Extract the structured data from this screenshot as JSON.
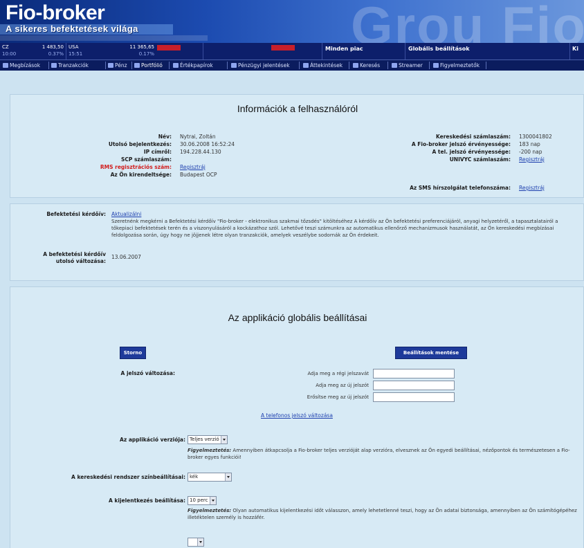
{
  "header": {
    "logo": "Fio-broker",
    "slogan": "A sikeres befektetések világa",
    "watermark": "Grou Fio"
  },
  "ticker": {
    "cz_label": "CZ",
    "cz_value": "1 483,50",
    "cz_time": "10:00",
    "cz_change": "0.37%",
    "usa_label": "USA",
    "usa_time": "15:51",
    "usa_value": "11 365,65",
    "usa_change": "0.17%",
    "market": "Minden piac",
    "global": "Globális beállítások",
    "right": "Ki"
  },
  "nav": {
    "tabs": [
      {
        "label": "Megbízások",
        "icon": "orders-icon"
      },
      {
        "label": "Tranzakciók",
        "icon": "transactions-icon"
      },
      {
        "label": "Pénz",
        "icon": "money-icon"
      },
      {
        "label": "Portfólió",
        "icon": "portfolio-icon"
      },
      {
        "label": "Értékpapírok",
        "icon": "securities-icon"
      },
      {
        "label": "Pénzügyi jelentések",
        "icon": "reports-icon"
      },
      {
        "label": "Áttekintések",
        "icon": "overview-icon"
      },
      {
        "label": "Keresés",
        "icon": "search-icon"
      },
      {
        "label": "Streamer",
        "icon": "streamer-icon"
      },
      {
        "label": "Figyelmeztetők",
        "icon": "alerts-icon"
      }
    ]
  },
  "user_info": {
    "title": "Információk a felhasználóról",
    "left": [
      {
        "label": "Név:",
        "value": "Nytrai, Zoltán"
      },
      {
        "label": "Utolsó bejelentkezés:",
        "value": "30.06.2008 16:52:24"
      },
      {
        "label": "IP címről:",
        "value": "194.228.44.130"
      },
      {
        "label": "SCP számlaszám:",
        "value": ""
      },
      {
        "label": "RMS regisztrációs szám:",
        "value": "Regisztráj"
      },
      {
        "label": "Az Ön kirendeltsége:",
        "value": "Budapest OCP"
      }
    ],
    "right": [
      {
        "label": "Kereskedési számlaszám:",
        "value": "1300041802"
      },
      {
        "label": "A Fio-broker jelszó érvényessége:",
        "value": "183 nap"
      },
      {
        "label": "A tel. jelszó érvényessége:",
        "value": "-200 nap"
      },
      {
        "label": "UNIVYC számlaszám:",
        "value": "Regisztráj"
      },
      {
        "label": "Az SMS hírszolgálat telefonszáma:",
        "value": "Regisztráj"
      }
    ]
  },
  "questionnaire": {
    "label": "Befektetési kérdőív:",
    "link": "Aktualizálni",
    "text": "Szeretnénk megkérni a Befektetési kérdőív \"Fio-broker - elektronikus szakmai tőzsdés\" kitöltéséhez A kérdőív az Ön befektetési preferenciájáról, anyagi helyzetéről, a tapasztalatairól a tőkepiaci befektetések terén és a viszonyulásáról a kockázathoz szól. Lehetővé teszi számunkra az automatikus ellenőrző mechanizmusok használatát, az Ön kereskedési megbízásai feldolgozása során, úgy hogy ne jöjjenek létre olyan tranzakciók, amelyek veszélybe sodornák az Ön érdekeit.",
    "last_change_label_1": "A befektetési kérdőív",
    "last_change_label_2": "utolsó változása:",
    "last_change_value": "13.06.2007"
  },
  "global_settings": {
    "title": "Az applikáció globális beállításai",
    "storno": "Storno",
    "save": "Beállítások mentése",
    "password_label": "A jelszó változása:",
    "old_pw": "Adja meg a régi jelszavát",
    "new_pw": "Adja meg az új jelszót",
    "confirm_pw": "Erősítse meg az új jelszót",
    "phone_pw_link": "A telefonos jelszó változása",
    "version_label": "Az applikáció verziója:",
    "version_value": "Teljes verzió",
    "version_warn_bold": "Figyelmeztetés:",
    "version_warn": "Amennyiben átkapcsolja a Fio-broker teljes verzióját alap verzióra, elvesznek az Ön egyedi beállításai, nézőpontok és természetesen a Fio-broker egyes funkciói!",
    "color_label": "A kereskedési rendszer színbeállításai:",
    "color_value": "kék",
    "logout_label": "A kijelentkezés beállítása:",
    "logout_value": "10 perc",
    "logout_warn_bold": "Figyelmeztetés:",
    "logout_warn": "Olyan automatikus kijelentkezési időt válasszon, amely lehetetlenné teszi, hogy az Ön adatai biztonsága, amennyiben az Ön számítógépéhez illetéktelen személy is hozzáfér."
  }
}
